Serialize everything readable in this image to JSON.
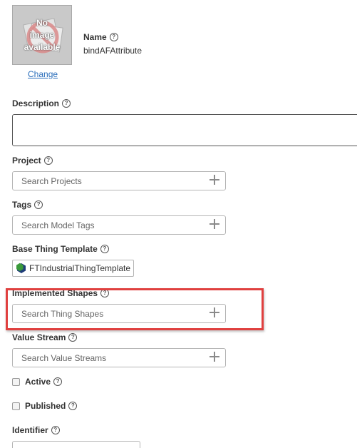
{
  "thumbnail": {
    "text_line1": "No",
    "text_line2": "image",
    "text_line3": "available",
    "change_label": "Change"
  },
  "name": {
    "label": "Name",
    "value": "bindAFAttribute"
  },
  "description": {
    "label": "Description",
    "value": ""
  },
  "project": {
    "label": "Project",
    "placeholder": "Search Projects"
  },
  "tags": {
    "label": "Tags",
    "placeholder": "Search Model Tags"
  },
  "base_thing_template": {
    "label": "Base Thing Template",
    "value": "FTIndustrialThingTemplate"
  },
  "implemented_shapes": {
    "label": "Implemented Shapes",
    "placeholder": "Search Thing Shapes"
  },
  "value_stream": {
    "label": "Value Stream",
    "placeholder": "Search Value Streams"
  },
  "active": {
    "label": "Active",
    "checked": false
  },
  "published": {
    "label": "Published",
    "checked": false
  },
  "identifier": {
    "label": "Identifier"
  },
  "help_glyph": "?",
  "colors": {
    "link": "#2a6ebb",
    "highlight": "#e0403f",
    "template_icon_green": "#3a9a3a",
    "template_icon_navy": "#1f3d78"
  }
}
